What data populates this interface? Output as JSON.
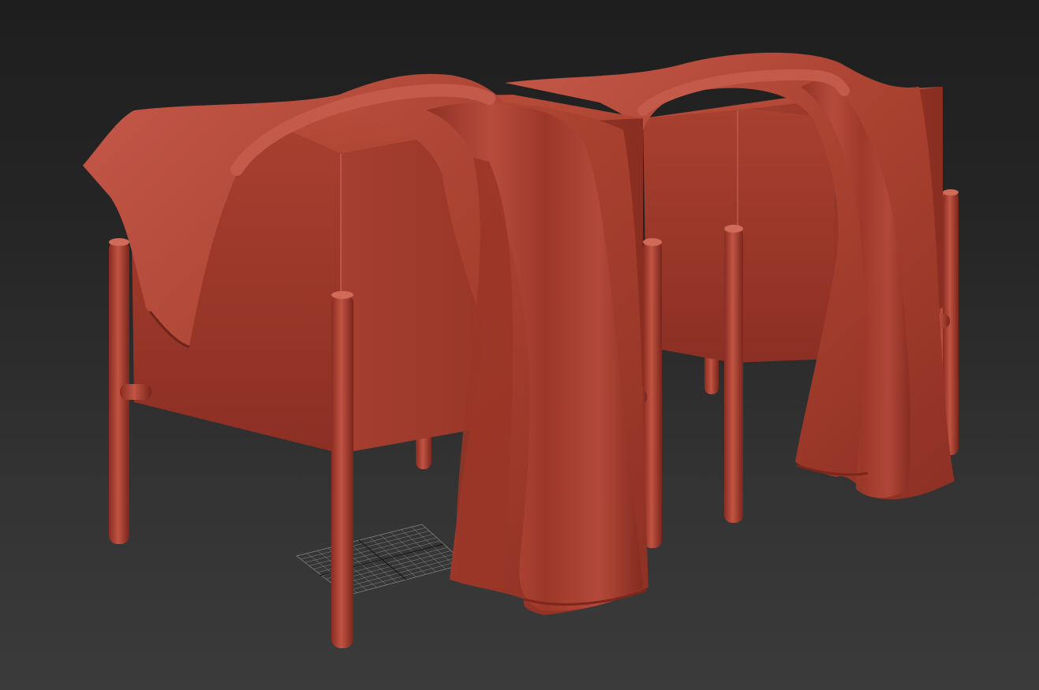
{
  "viewport": {
    "background_top": "#1e1e1e",
    "background_bottom": "#3b3b3b",
    "grid_color": "#8a8a8a",
    "grid_axis_color": "#1a1a1a"
  },
  "scene": {
    "objects": [
      "ottoman-left",
      "ottoman-right",
      "throw-blanket-left",
      "throw-blanket-right",
      "home-grid"
    ],
    "material_color": "#b5483b",
    "material_shadow": "#6e241c",
    "material_highlight": "#cf6a5c"
  }
}
